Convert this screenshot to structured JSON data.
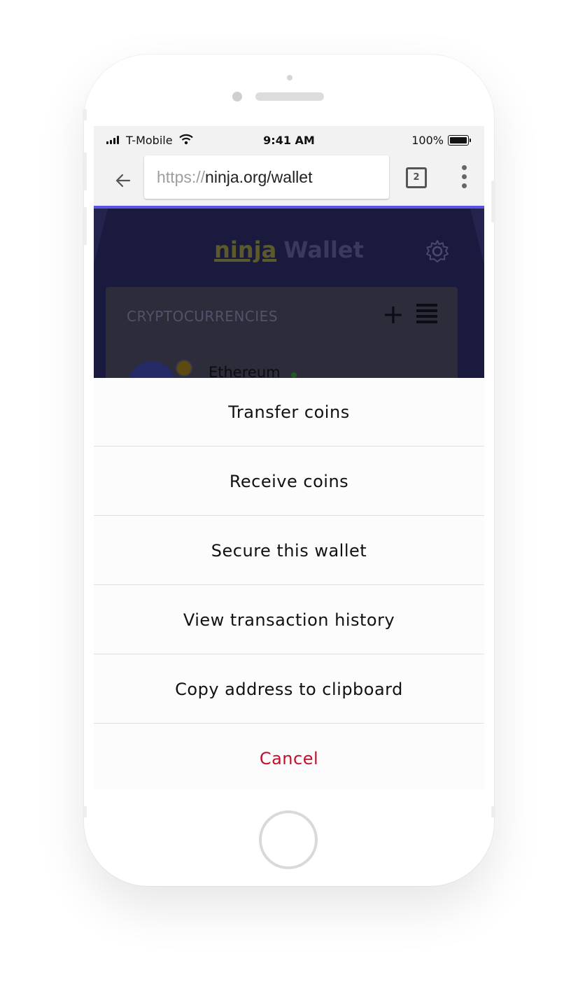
{
  "status_bar": {
    "carrier": "T-Mobile",
    "time": "9:41 AM",
    "battery": "100%"
  },
  "browser": {
    "url_scheme": "https://",
    "url_host": "ninja.org/wallet",
    "tab_count": "2"
  },
  "page": {
    "brand_prefix": "ninja",
    "brand_suffix": "Wallet",
    "section_title": "CRYPTOCURRENCIES",
    "coin_name": "Ethereum"
  },
  "action_sheet": {
    "items": [
      {
        "label": "Transfer coins"
      },
      {
        "label": "Receive coins"
      },
      {
        "label": "Secure this wallet"
      },
      {
        "label": "View transaction history"
      },
      {
        "label": "Copy address to clipboard"
      }
    ],
    "cancel": "Cancel"
  },
  "colors": {
    "progress": "#5b53e6",
    "cancel": "#c0102a",
    "page_bg": "#1a1a3e"
  }
}
